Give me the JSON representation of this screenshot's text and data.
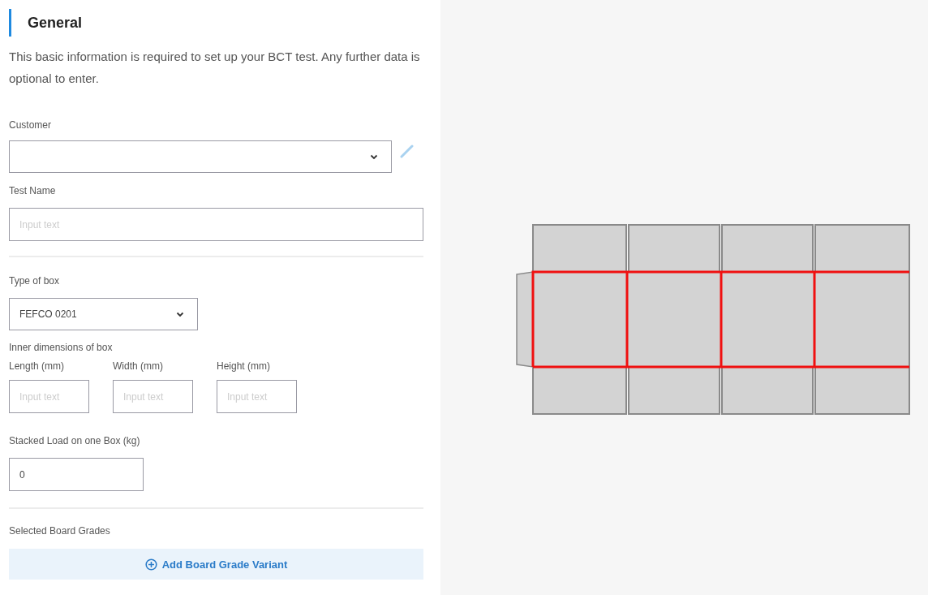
{
  "section": {
    "title": "General",
    "description": "This basic information is required to set up your BCT test. Any further data is optional to enter."
  },
  "customer": {
    "label": "Customer"
  },
  "test_name": {
    "label": "Test Name",
    "placeholder": "Input text"
  },
  "type_of_box": {
    "label": "Type of box",
    "value": "FEFCO 0201"
  },
  "dimensions": {
    "label": "Inner dimensions of box",
    "fields": [
      {
        "label": "Length (mm)",
        "placeholder": "Input text"
      },
      {
        "label": "Width (mm)",
        "placeholder": "Input text"
      },
      {
        "label": "Height (mm)",
        "placeholder": "Input text"
      }
    ]
  },
  "stacked_load": {
    "label": "Stacked Load on one Box (kg)",
    "value": "0"
  },
  "board_grades": {
    "label": "Selected Board Grades",
    "button": "Add Board Grade Variant"
  }
}
